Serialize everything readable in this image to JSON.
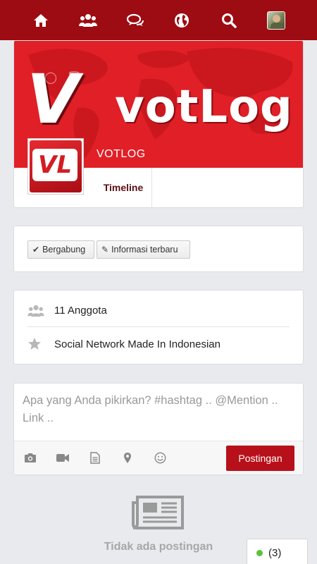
{
  "nav": {
    "icons": [
      "home-icon",
      "groups-icon",
      "messages-icon",
      "globe-icon",
      "search-icon",
      "avatar"
    ]
  },
  "cover": {
    "logo_letter": "V",
    "logo_text": "votLog",
    "page_name": "VOTLOG",
    "profile_pic_text": "VL"
  },
  "tabs": {
    "timeline": "Timeline"
  },
  "actions": {
    "join_label": "Bergabung",
    "info_label": "Informasi terbaru"
  },
  "info": {
    "members": "11 Anggota",
    "description": "Social Network Made In Indonesian"
  },
  "composer": {
    "placeholder": "Apa yang Anda pikirkan? #hashtag .. @Mention .. Link ..",
    "post_label": "Postingan"
  },
  "empty": {
    "text": "Tidak ada postingan"
  },
  "online": {
    "count": "(3)"
  },
  "colors": {
    "brand": "#9d0b13",
    "cover": "#e01f27",
    "post_button": "#b8101a",
    "online": "#5ec13a"
  }
}
